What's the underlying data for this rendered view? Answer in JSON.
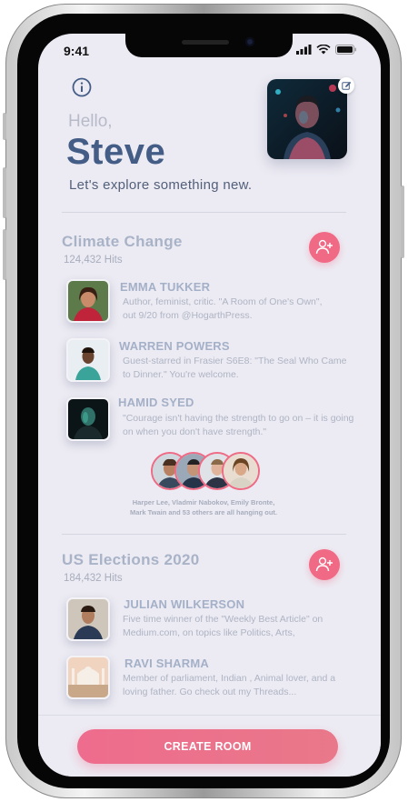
{
  "status_bar": {
    "time": "9:41"
  },
  "header": {
    "greeting": "Hello,",
    "user_name": "Steve",
    "tagline": "Let's explore something new."
  },
  "rooms": [
    {
      "title": "Climate Change",
      "hits": "124,432 Hits",
      "members": [
        {
          "name": "EMMA TUKKER",
          "bio": "Author, feminist, critic. \"A Room of One's Own\", out 9/20 from @HogarthPress."
        },
        {
          "name": "WARREN POWERS",
          "bio": "Guest-starred in Frasier S6E8: \"The Seal Who Came to Dinner.\" You're welcome."
        },
        {
          "name": "HAMID SYED",
          "bio": "\"Courage isn't having the strength to go on – it is going on when you don't have strength.\""
        }
      ],
      "others_caption": "Harper Lee, Vladmir Nabokov, Emily Bronte, Mark Twain and 53 others are all hanging out."
    },
    {
      "title": "US Elections 2020",
      "hits": "184,432 Hits",
      "members": [
        {
          "name": "JULIAN WILKERSON",
          "bio": "Five time winner of the \"Weekly Best Article\" on Medium.com, on topics like Politics, Arts,"
        },
        {
          "name": "RAVI SHARMA",
          "bio": "Member of parliament, Indian , Animal lover, and a loving father. Go check out my Threads..."
        }
      ]
    }
  ],
  "footer": {
    "create_room_label": "CREATE ROOM"
  },
  "colors": {
    "accent": "#f06a86",
    "name_blue": "#445d86",
    "background": "#ecebf3"
  }
}
